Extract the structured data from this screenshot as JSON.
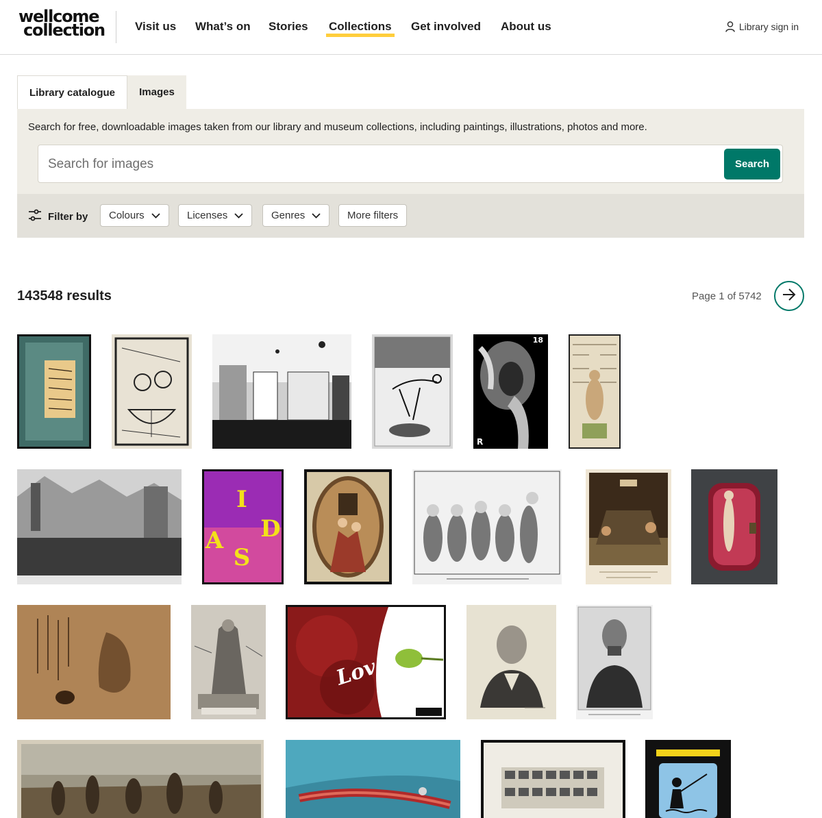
{
  "header": {
    "logo_line1": "wellcome",
    "logo_line2": "collection",
    "nav": [
      "Visit us",
      "What’s on",
      "Stories",
      "Collections",
      "Get involved",
      "About us"
    ],
    "active_nav": "Collections",
    "signin_label": "Library sign in",
    "accent_color": "#ffce3c"
  },
  "tabs": {
    "catalogue_label": "Library catalogue",
    "images_label": "Images"
  },
  "search": {
    "description": "Search for free, downloadable images taken from our library and museum collections, including paintings, illustrations, photos and more.",
    "placeholder": "Search for images",
    "value": "",
    "button_label": "Search",
    "button_color": "#007868"
  },
  "filters": {
    "label": "Filter by",
    "buttons": [
      "Colours",
      "Licenses",
      "Genres",
      "More filters"
    ]
  },
  "results": {
    "count_text": "143548 results",
    "page_text": "Page 1 of 5742"
  },
  "image_icons": [
    "calligraphy-thumb",
    "engraving-thumb",
    "museum-photo-thumb",
    "skeleton-thumb",
    "xray-thumb",
    "anatomy-thumb",
    "procession-thumb",
    "aids-poster-thumb",
    "oval-painting-thumb",
    "caricature-thumb",
    "bath-painting-thumb",
    "figurine-case-thumb",
    "scroll-painting-thumb",
    "saint-engraving-thumb",
    "love-poster-thumb",
    "portrait-lithograph-thumb",
    "portrait-photo-thumb",
    "oil-painting-thumb",
    "surgery-photo-thumb",
    "motion-study-thumb",
    "hiv-poster-thumb"
  ]
}
